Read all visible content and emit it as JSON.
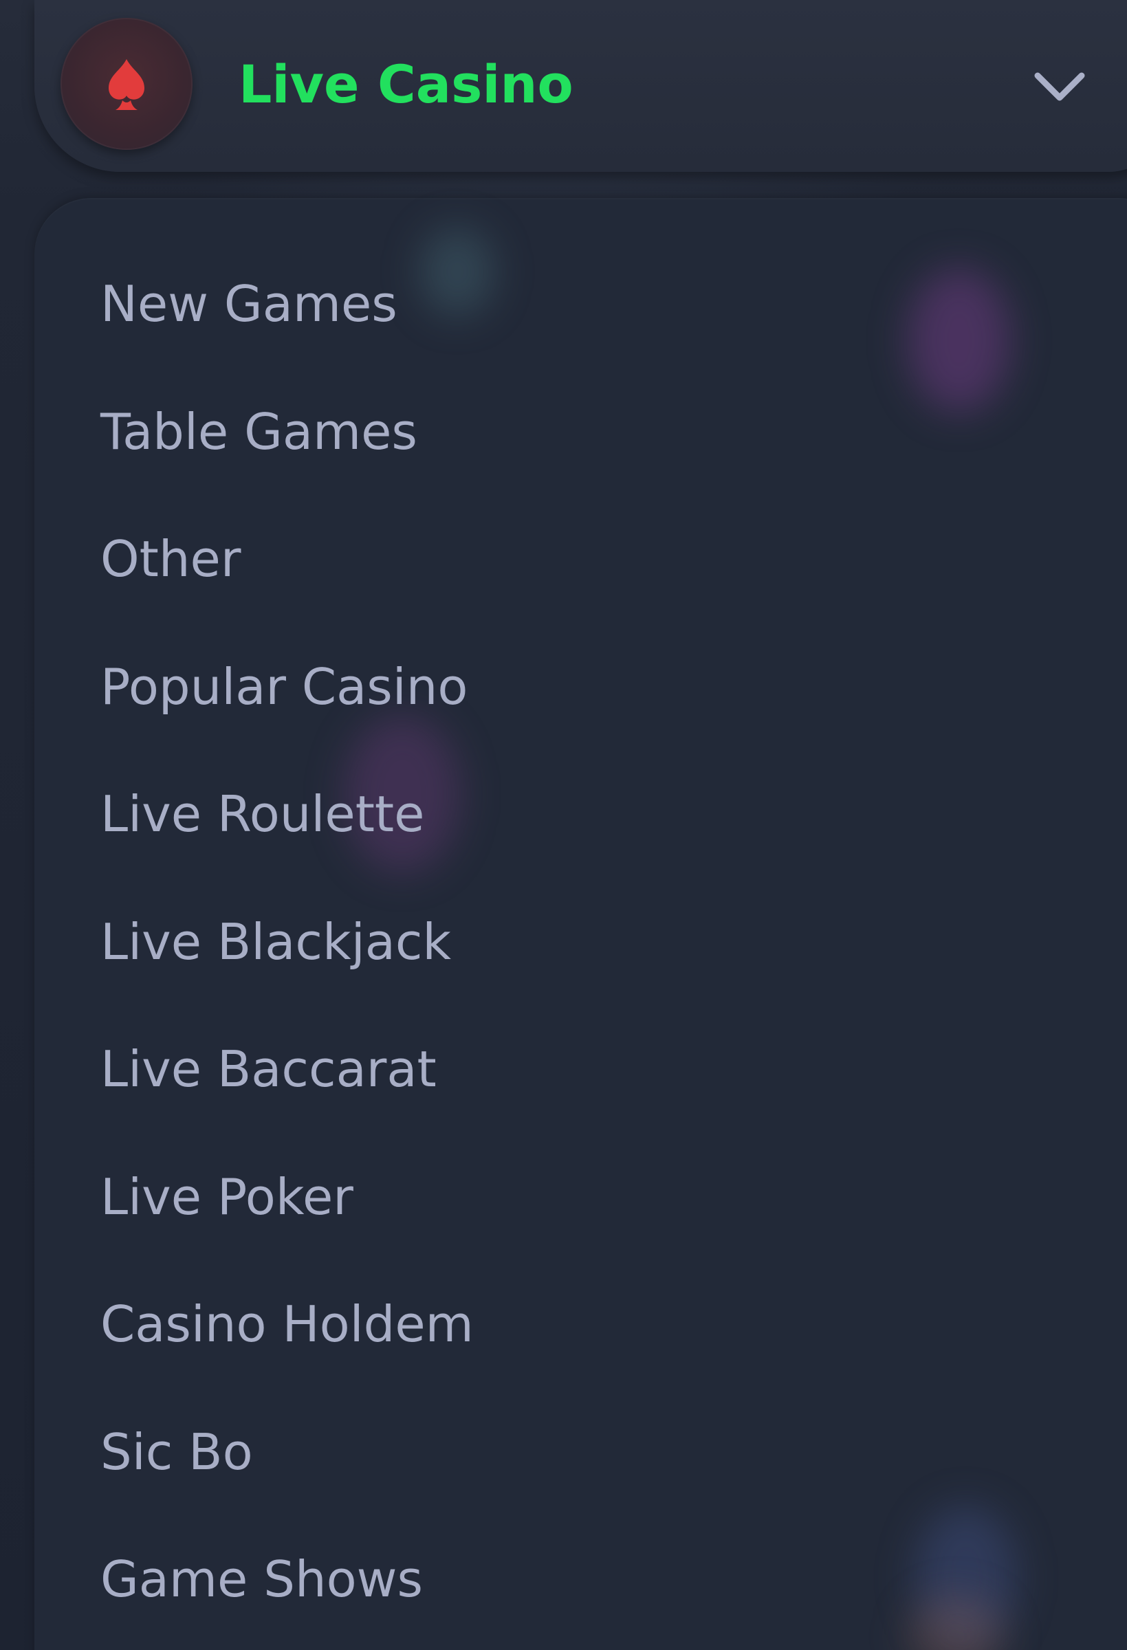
{
  "header": {
    "title": "Live Casino",
    "icon": "spade-icon",
    "expand_icon": "chevron-down-icon",
    "accent_color": "#22e05e",
    "icon_color": "#e23c3c"
  },
  "menu": {
    "items": [
      {
        "label": "New Games"
      },
      {
        "label": "Table Games"
      },
      {
        "label": "Other"
      },
      {
        "label": "Popular Casino"
      },
      {
        "label": "Live Roulette"
      },
      {
        "label": "Live Blackjack"
      },
      {
        "label": "Live Baccarat"
      },
      {
        "label": "Live Poker"
      },
      {
        "label": "Casino Holdem"
      },
      {
        "label": "Sic Bo"
      },
      {
        "label": "Game Shows"
      }
    ],
    "text_color": "#a8aec6"
  }
}
